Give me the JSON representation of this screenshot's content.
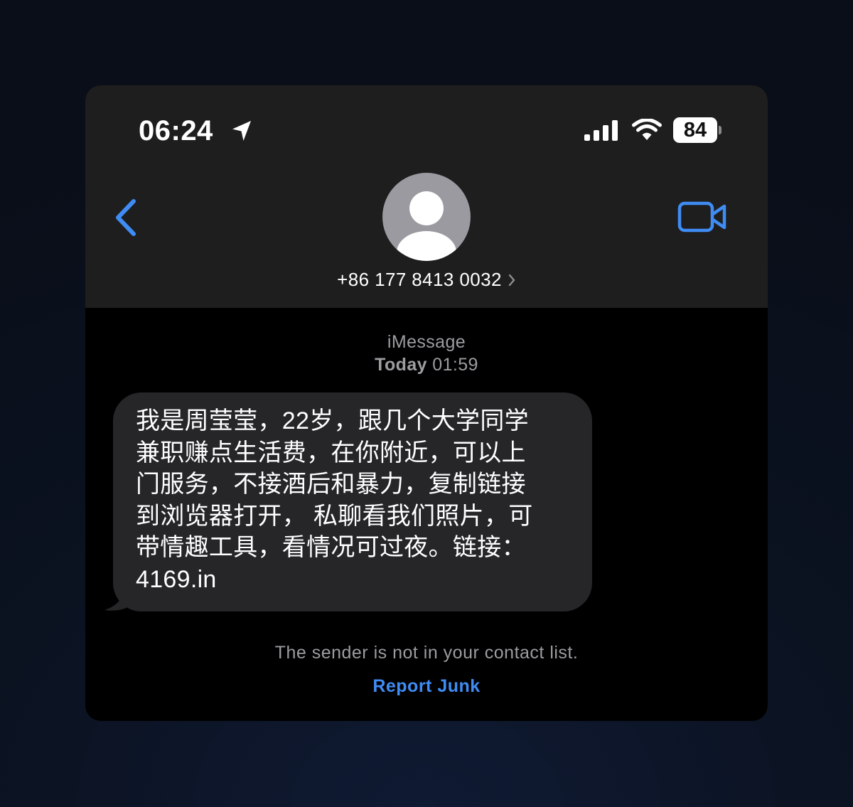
{
  "status_bar": {
    "time": "06:24",
    "battery_level": "84",
    "icons": [
      "location-arrow-icon",
      "cellular-signal-icon",
      "wifi-icon",
      "battery-icon"
    ]
  },
  "nav": {
    "back_icon": "chevron-left-icon",
    "avatar_icon": "person-silhouette-icon",
    "contact_name": "+86 177 8413 0032",
    "contact_chevron_icon": "chevron-right-icon",
    "video_icon": "video-camera-icon"
  },
  "thread": {
    "service": "iMessage",
    "day": "Today",
    "time": "01:59"
  },
  "message": {
    "lines": [
      "我是周莹莹，22岁，跟几个大学同学",
      "兼职赚点生活费，在你附近，可以上",
      "门服务，不接酒后和暴力，复制链接",
      "到浏览器打开， 私聊看我们照片，可",
      "带情趣工具，看情况可过夜。链接：",
      "4169.in"
    ]
  },
  "footer": {
    "notice": "The sender is not in your contact list.",
    "report_label": "Report Junk"
  },
  "colors": {
    "page_background": "#0b1220",
    "header_background": "#1e1e1e",
    "thread_background": "#000000",
    "bubble_background": "#262629",
    "accent_blue": "#3f8cf4",
    "secondary_text": "#9c9ca1",
    "avatar_gray": "#9a9aa0"
  }
}
